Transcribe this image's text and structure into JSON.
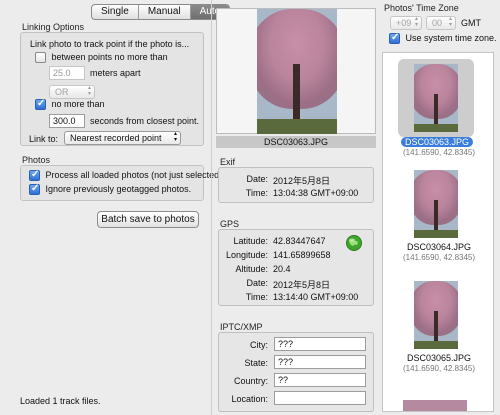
{
  "mode_tabs": [
    "Single",
    "Manual",
    "Auto"
  ],
  "mode_selected": "Auto",
  "linking": {
    "title": "Linking Options",
    "subtitle": "Link photo to track point if the photo is...",
    "between_label": "between points no more than",
    "between_checked": false,
    "between_value": "25.0",
    "meters_label": "meters apart",
    "or_value": "OR",
    "no_more_label": "no more than",
    "no_more_checked": true,
    "seconds_value": "300.0",
    "seconds_label": "seconds from closest point.",
    "link_to_label": "Link to:",
    "link_to_value": "Nearest recorded point"
  },
  "photos_group": {
    "title": "Photos",
    "process_label": "Process all loaded photos (not just selected).",
    "process_checked": true,
    "ignore_label": "Ignore previously geotagged photos.",
    "ignore_checked": true
  },
  "batch_save_label": "Batch save to photos",
  "status_text": "Loaded 1 track files.",
  "preview": {
    "filename": "DSC03063.JPG"
  },
  "exif": {
    "title": "Exif",
    "date_label": "Date:",
    "date_value": "2012年5月8日",
    "time_label": "Time:",
    "time_value": "13:04:38 GMT+09:00"
  },
  "gps": {
    "title": "GPS",
    "latitude_label": "Latitude:",
    "latitude_value": "42.83447647",
    "longitude_label": "Longitude:",
    "longitude_value": "141.65899658",
    "altitude_label": "Altitude:",
    "altitude_value": "20.4",
    "date_label": "Date:",
    "date_value": "2012年5月8日",
    "time_label": "Time:",
    "time_value": "13:14:40 GMT+09:00"
  },
  "iptc": {
    "title": "IPTC/XMP",
    "city_label": "City:",
    "city_value": "???",
    "state_label": "State:",
    "state_value": "???",
    "country_label": "Country:",
    "country_value": "??",
    "location_label": "Location:",
    "location_value": ""
  },
  "timezone": {
    "title": "Photos' Time Zone",
    "hours_value": "+09",
    "minutes_value": "00",
    "gmt_label": "GMT",
    "use_system_label": "Use system time zone.",
    "use_system_checked": true
  },
  "thumbnails": [
    {
      "name": "DSC03063.JPG",
      "coords": "(141.6590, 42.8345)",
      "selected": true
    },
    {
      "name": "DSC03064.JPG",
      "coords": "(141.6590, 42.8345)",
      "selected": false
    },
    {
      "name": "DSC03065.JPG",
      "coords": "(141.6590, 42.8345)",
      "selected": false
    }
  ],
  "colors": {
    "accent": "#3b7ddd",
    "globe": "#4caf2e"
  }
}
